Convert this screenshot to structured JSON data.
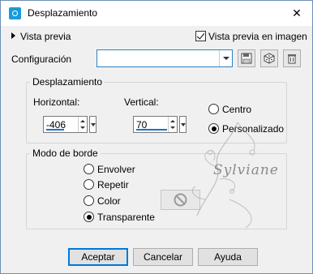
{
  "window": {
    "title": "Desplazamiento",
    "close_glyph": "✕"
  },
  "preview": {
    "toggle_label": "Vista previa",
    "live_label": "Vista previa en imagen",
    "live_checked": true
  },
  "config": {
    "label": "Configuración",
    "value": ""
  },
  "offset_group": {
    "title": "Desplazamiento",
    "horizontal_label": "Horizontal:",
    "horizontal_value": "-406",
    "vertical_label": "Vertical:",
    "vertical_value": "70",
    "center_label": "Centro",
    "custom_label": "Personalizado",
    "selected": "Personalizado"
  },
  "border_group": {
    "title": "Modo de borde",
    "options": [
      "Envolver",
      "Repetir",
      "Color",
      "Transparente"
    ],
    "selected": "Transparente"
  },
  "watermark_text": "Sylviane",
  "buttons": {
    "ok": "Aceptar",
    "cancel": "Cancelar",
    "help": "Ayuda"
  }
}
